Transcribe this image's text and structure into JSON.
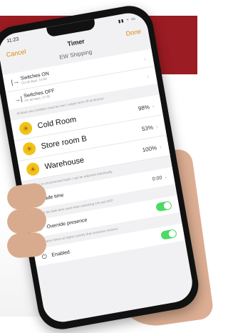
{
  "status": {
    "time": "11:23"
  },
  "nav": {
    "cancel": "Cancel",
    "title": "Timer",
    "done": "Done"
  },
  "subtitle": "EW Shipping",
  "switch_rows": [
    {
      "label": "Switches ON",
      "sub": "On all days, 14:00"
    },
    {
      "label": "Switches OFF",
      "sub": "On all days, 17:00"
    }
  ],
  "note_top": "At least one condition must be met / output turns off at timeout",
  "zones": [
    {
      "name": "Cold Room",
      "pct": "98%"
    },
    {
      "name": "Store room B",
      "pct": "53%"
    },
    {
      "name": "Warehouse",
      "pct": "100%"
    }
  ],
  "note_zones": "Scenes or unconnected loads / can be adjusted individually",
  "fade": {
    "label": "Fade time",
    "value": "0:00"
  },
  "fade_note": "Defines the fade time used when switching ON and OFF",
  "override": {
    "label": "Override presence",
    "on": true
  },
  "override_note": "Activates timers at higher priority than presence sensors",
  "enabled": {
    "label": "Enabled",
    "on": true
  },
  "icons": [
    "switch-on-icon",
    "switch-off-icon",
    "sun-icon",
    "clock-icon",
    "person-icon",
    "power-icon",
    "chevron-right-icon"
  ],
  "colors": {
    "banner": "#9b1c22",
    "accent": "#d88b0e",
    "toggle": "#4cd964",
    "sun": "#f3c21a"
  }
}
